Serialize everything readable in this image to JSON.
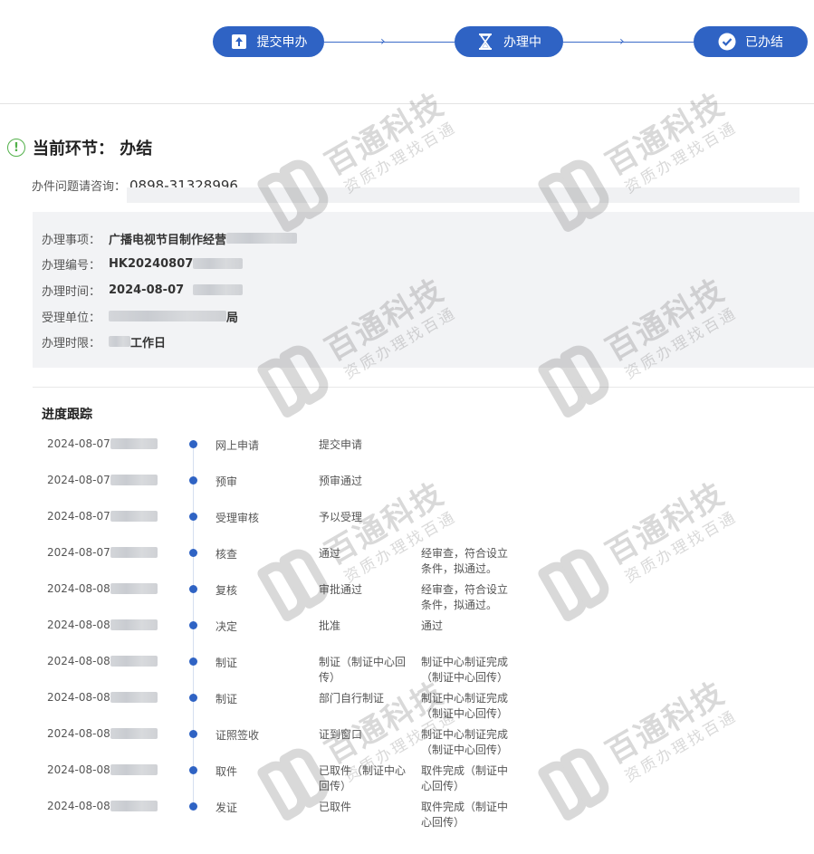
{
  "steps": [
    {
      "label": "提交申办",
      "icon": "upload-icon"
    },
    {
      "label": "办理中",
      "icon": "hourglass-icon"
    },
    {
      "label": "已办结",
      "icon": "check-circle-icon"
    }
  ],
  "stage": {
    "label": "当前环节：",
    "value": "办结"
  },
  "consult": {
    "label": "办件问题请咨询：",
    "phone": "0898-31328996"
  },
  "details": {
    "item_label": "办理事项：",
    "item_value": "广播电视节目制作经营",
    "number_label": "办理编号：",
    "number_value": "HK20240807",
    "time_label": "办理时间：",
    "time_value": "2024-08-07",
    "unit_label": "受理单位：",
    "unit_suffix": "局",
    "limit_label": "办理时限：",
    "limit_suffix": "工作日"
  },
  "progress": {
    "title": "进度跟踪",
    "rows": [
      {
        "date": "2024-08-07",
        "node": "网上申请",
        "action": "提交申请",
        "opinion": ""
      },
      {
        "date": "2024-08-07",
        "node": "预审",
        "action": "预审通过",
        "opinion": ""
      },
      {
        "date": "2024-08-07",
        "node": "受理审核",
        "action": "予以受理",
        "opinion": ""
      },
      {
        "date": "2024-08-07",
        "node": "核查",
        "action": "通过",
        "opinion": "经审查，符合设立条件，拟通过。"
      },
      {
        "date": "2024-08-08",
        "node": "复核",
        "action": "审批通过",
        "opinion": "经审查，符合设立条件，拟通过。"
      },
      {
        "date": "2024-08-08",
        "node": "决定",
        "action": "批准",
        "opinion": "通过"
      },
      {
        "date": "2024-08-08",
        "node": "制证",
        "action": "制证（制证中心回传）",
        "opinion": "制证中心制证完成（制证中心回传）"
      },
      {
        "date": "2024-08-08",
        "node": "制证",
        "action": "部门自行制证",
        "opinion": "制证中心制证完成（制证中心回传）"
      },
      {
        "date": "2024-08-08",
        "node": "证照签收",
        "action": "证到窗口",
        "opinion": "制证中心制证完成（制证中心回传）"
      },
      {
        "date": "2024-08-08",
        "node": "取件",
        "action": "已取件（制证中心回传）",
        "opinion": "取件完成（制证中心回传）"
      },
      {
        "date": "2024-08-08",
        "node": "发证",
        "action": "已取件",
        "opinion": "取件完成（制证中心回传）"
      }
    ]
  },
  "watermark": {
    "brand": "百通科技",
    "slogan": "资质办理找百通"
  },
  "colors": {
    "accent": "#2f63c4",
    "ok_green": "#52b14a"
  }
}
